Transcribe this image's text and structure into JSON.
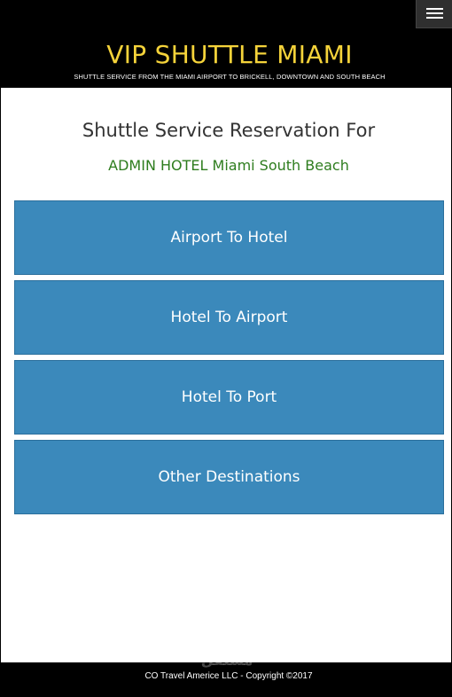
{
  "header": {
    "title": "VIP SHUTTLE MIAMI",
    "subtitle": "SHUTTLE SERVICE FROM THE MIAMI AIRPORT TO BRICKELL, DOWNTOWN AND SOUTH BEACH",
    "menu_icon": "hamburger-menu-icon"
  },
  "main": {
    "heading": "Shuttle Service Reservation For",
    "hotel": "ADMIN HOTEL Miami South Beach",
    "options": [
      {
        "label": "Airport To Hotel"
      },
      {
        "label": "Hotel To Airport"
      },
      {
        "label": "Hotel To Port"
      },
      {
        "label": "Other Destinations"
      }
    ]
  },
  "footer": {
    "copyright": "CO Travel Americe LLC - Copyright ©2017",
    "watermark": "مستقل"
  },
  "colors": {
    "header_bg": "#000000",
    "title": "#f5d33a",
    "hotel_name": "#2e7d1e",
    "button_bg": "#3b89bb",
    "button_text": "#ffffff"
  }
}
